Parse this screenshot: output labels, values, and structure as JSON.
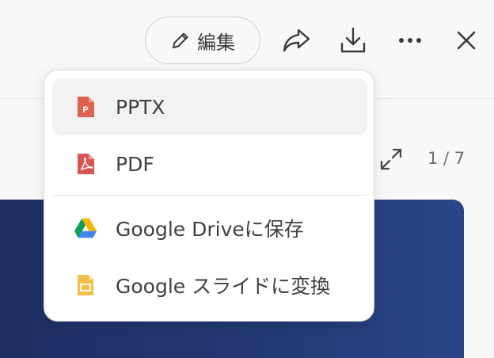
{
  "toolbar": {
    "edit_label": "編集",
    "icons": [
      "pencil-icon",
      "share-icon",
      "download-icon",
      "more-icon",
      "close-icon"
    ]
  },
  "viewer": {
    "page_counter": "1 / 7"
  },
  "download_menu": {
    "items": [
      {
        "label": "PPTX",
        "icon": "pptx-file-icon",
        "color": "#e0604e"
      },
      {
        "label": "PDF",
        "icon": "pdf-file-icon",
        "color": "#d9534f"
      },
      {
        "label": "Google Driveに保存",
        "icon": "google-drive-icon"
      },
      {
        "label": "Google スライドに変換",
        "icon": "google-slides-icon",
        "color": "#f2c04a"
      }
    ]
  },
  "colors": {
    "accent_slide": "#243a74",
    "menu_hover": "#f2f2f2"
  }
}
